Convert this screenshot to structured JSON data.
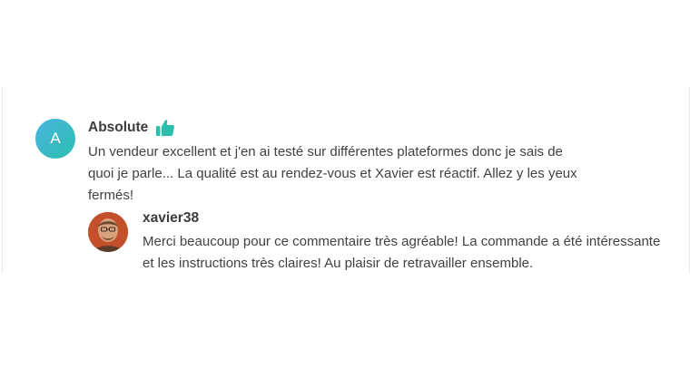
{
  "review": {
    "avatar_letter": "A",
    "author": "Absolute",
    "thumb_icon": "thumbs-up-icon",
    "text": "Un vendeur excellent et j'en ai testé sur différentes plateformes donc je sais de quoi je parle... La qualité est au rendez-vous et Xavier est réactif. Allez y les yeux fermés!"
  },
  "reply": {
    "author": "xavier38",
    "text": "Merci beaucoup pour ce commentaire très agréable! La commande a été intéressante et les instructions très claires! Au plaisir de retravailler ensemble."
  },
  "colors": {
    "accent_teal": "#2bbfae",
    "avatar_gradient_start": "#4ab3e0",
    "text": "#404145"
  }
}
